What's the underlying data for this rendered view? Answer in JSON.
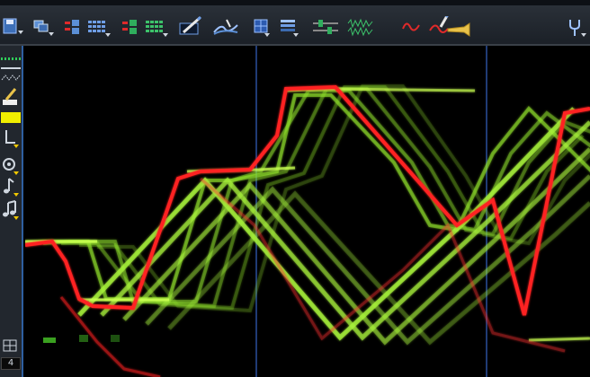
{
  "toolbar": {
    "icons": [
      "save-icon",
      "layers-icon",
      "track-add-icon",
      "grid-view-icon",
      "track-add-alt-icon",
      "grid-view-alt-icon",
      "pencil-icon",
      "effect-icon",
      "grid-icon",
      "stack-icon",
      "mixer-icon",
      "waveform-icon",
      "curve-red-icon",
      "trumpet-icon",
      "fork-icon"
    ]
  },
  "sidebar": {
    "tools": [
      "snap-icon",
      "line-icon",
      "dotted-line-icon",
      "eraser-pencil-icon",
      "color-swatch-icon",
      "cursor-tool-icon",
      "rotate-tool-icon",
      "note-icon",
      "notes-icon",
      "grid-small-icon"
    ],
    "number_value": "4"
  },
  "colors": {
    "accent_red": "#ff2020",
    "accent_green": "#b0ff30",
    "swatch_yellow": "#f0ee00",
    "guide_blue": "#2b4f9c"
  }
}
